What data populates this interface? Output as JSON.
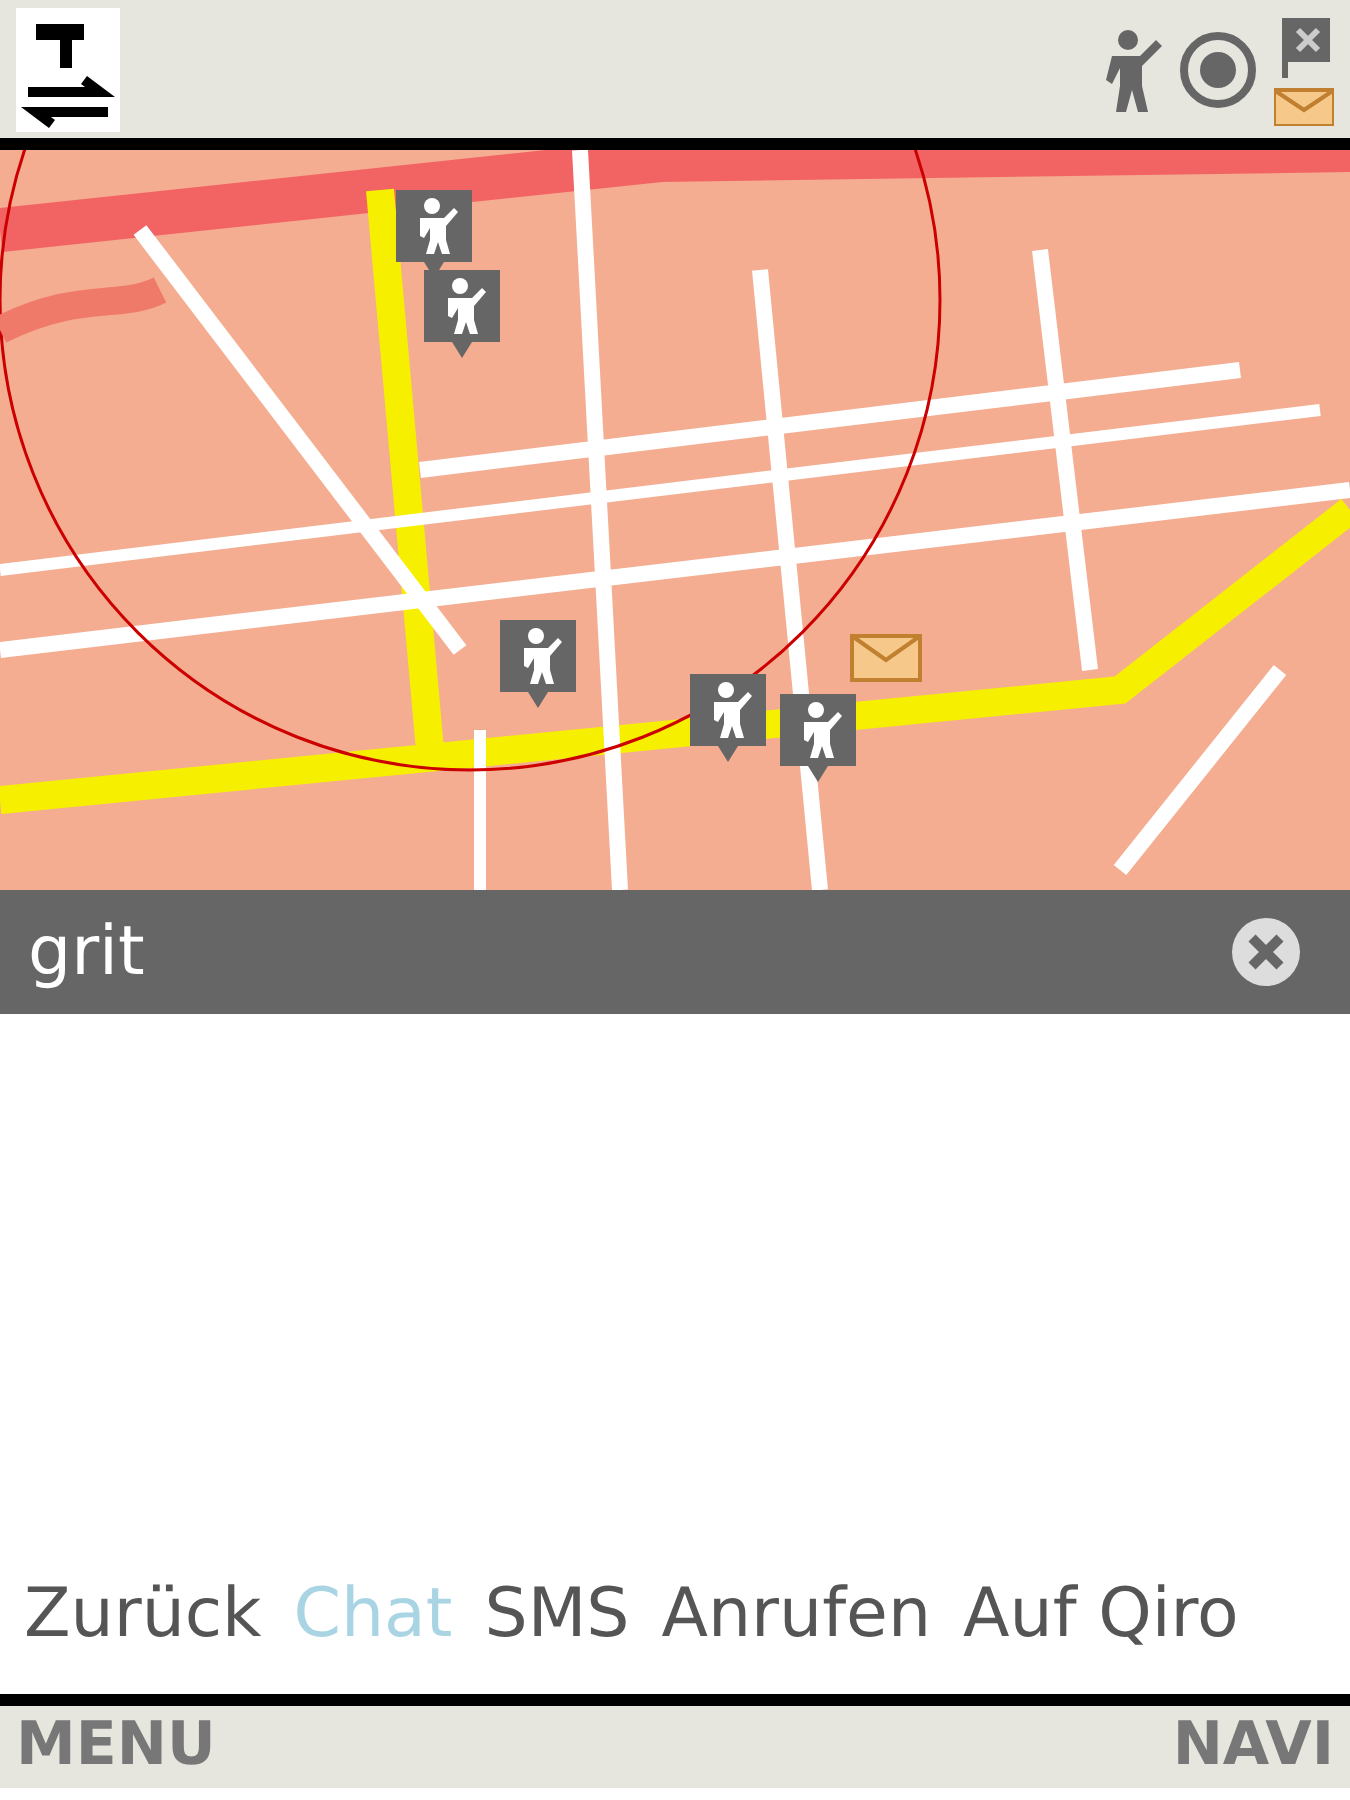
{
  "map": {
    "kind": "picture",
    "markers": [
      {
        "kind": "person"
      },
      {
        "kind": "person"
      },
      {
        "kind": "person"
      },
      {
        "kind": "person"
      },
      {
        "kind": "person"
      },
      {
        "kind": "message"
      }
    ]
  },
  "search": {
    "value": "grit"
  },
  "actions": [
    {
      "label": "Zurück",
      "selected": false
    },
    {
      "label": "Chat",
      "selected": true
    },
    {
      "label": "SMS",
      "selected": false
    },
    {
      "label": "Anrufen",
      "selected": false
    },
    {
      "label": "Auf Qiro",
      "selected": false
    }
  ],
  "softkeys": {
    "left": "MENU",
    "right": "NAVI"
  }
}
